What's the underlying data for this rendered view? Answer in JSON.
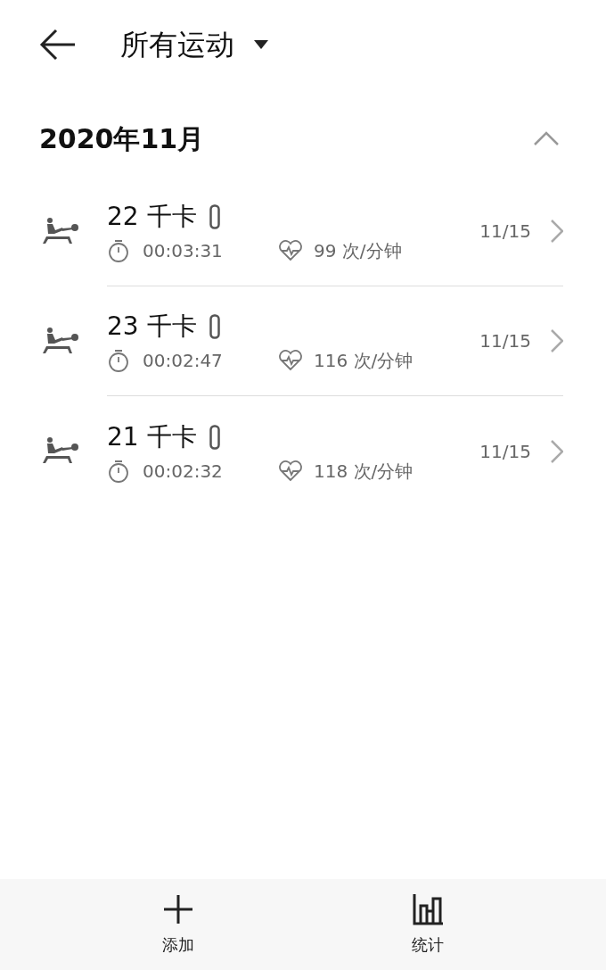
{
  "header": {
    "title": "所有运动"
  },
  "section": {
    "title": "2020年11月",
    "expanded": true
  },
  "records": [
    {
      "calories": "22 千卡",
      "duration": "00:03:31",
      "heart_rate": "99 次/分钟",
      "date": "11/15"
    },
    {
      "calories": "23 千卡",
      "duration": "00:02:47",
      "heart_rate": "116 次/分钟",
      "date": "11/15"
    },
    {
      "calories": "21 千卡",
      "duration": "00:02:32",
      "heart_rate": "118 次/分钟",
      "date": "11/15"
    }
  ],
  "bottom_bar": [
    {
      "kind": "add",
      "label": "添加"
    },
    {
      "kind": "stats",
      "label": "统计"
    }
  ]
}
